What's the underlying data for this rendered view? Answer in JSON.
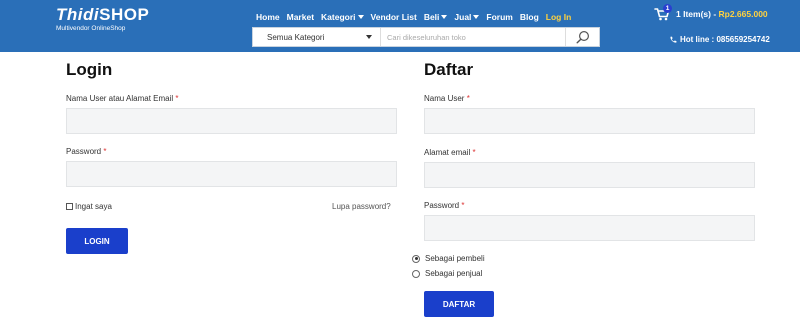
{
  "header": {
    "logo": {
      "main": "Thidi",
      "brand": "SHOP",
      "tagline": "Multivendor OnlineShop"
    },
    "nav": [
      {
        "label": "Home",
        "dropdown": false,
        "active": false
      },
      {
        "label": "Market",
        "dropdown": false,
        "active": false
      },
      {
        "label": "Kategori",
        "dropdown": true,
        "active": false
      },
      {
        "label": "Vendor List",
        "dropdown": false,
        "active": false
      },
      {
        "label": "Beli",
        "dropdown": true,
        "active": false
      },
      {
        "label": "Jual",
        "dropdown": true,
        "active": false
      },
      {
        "label": "Forum",
        "dropdown": false,
        "active": false
      },
      {
        "label": "Blog",
        "dropdown": false,
        "active": false
      },
      {
        "label": "Log In",
        "dropdown": false,
        "active": true
      }
    ],
    "cart": {
      "badge": "1",
      "items_text": "1 Item(s) - ",
      "total": "Rp2.665.000"
    },
    "hotline": "Hot line : 085659254742",
    "search": {
      "category": "Semua Kategori",
      "placeholder": "Cari dikeseluruhan toko",
      "value": ""
    }
  },
  "login": {
    "title": "Login",
    "username_label": "Nama User atau Alamat Email",
    "password_label": "Password",
    "required_mark": "*",
    "remember_label": "Ingat saya",
    "lost_password": "Lupa password?",
    "button": "LOGIN"
  },
  "register": {
    "title": "Daftar",
    "username_label": "Nama User",
    "email_label": "Alamat email",
    "password_label": "Password",
    "required_mark": "*",
    "role_options": [
      {
        "label": "Sebagai pembeli",
        "checked": true
      },
      {
        "label": "Sebagai penjual",
        "checked": false
      }
    ],
    "button": "DAFTAR"
  },
  "colors": {
    "header_bg": "#2a6fb8",
    "accent_yellow": "#ffd23f",
    "button_blue": "#1a3fcb"
  },
  "icons": [
    "cart-icon",
    "phone-icon",
    "search-icon",
    "chevron-down-icon"
  ]
}
